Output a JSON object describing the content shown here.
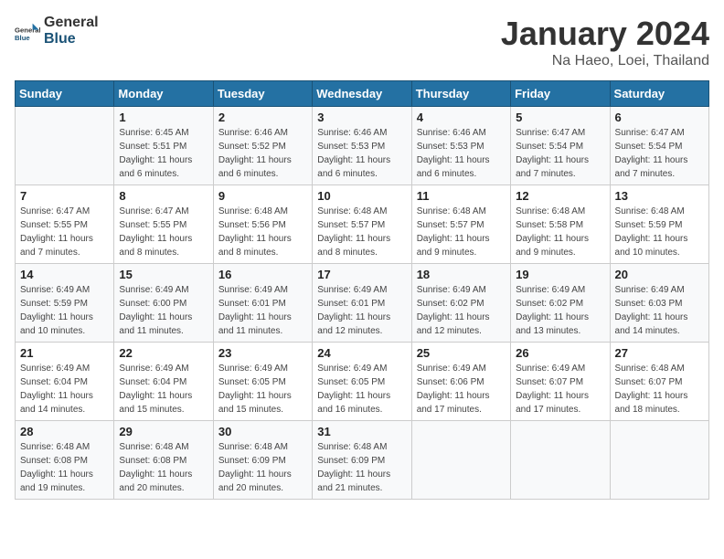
{
  "header": {
    "logo_general": "General",
    "logo_blue": "Blue",
    "month_title": "January 2024",
    "location": "Na Haeo, Loei, Thailand"
  },
  "calendar": {
    "weekdays": [
      "Sunday",
      "Monday",
      "Tuesday",
      "Wednesday",
      "Thursday",
      "Friday",
      "Saturday"
    ],
    "weeks": [
      [
        {
          "day": "",
          "info": ""
        },
        {
          "day": "1",
          "info": "Sunrise: 6:45 AM\nSunset: 5:51 PM\nDaylight: 11 hours\nand 6 minutes."
        },
        {
          "day": "2",
          "info": "Sunrise: 6:46 AM\nSunset: 5:52 PM\nDaylight: 11 hours\nand 6 minutes."
        },
        {
          "day": "3",
          "info": "Sunrise: 6:46 AM\nSunset: 5:53 PM\nDaylight: 11 hours\nand 6 minutes."
        },
        {
          "day": "4",
          "info": "Sunrise: 6:46 AM\nSunset: 5:53 PM\nDaylight: 11 hours\nand 6 minutes."
        },
        {
          "day": "5",
          "info": "Sunrise: 6:47 AM\nSunset: 5:54 PM\nDaylight: 11 hours\nand 7 minutes."
        },
        {
          "day": "6",
          "info": "Sunrise: 6:47 AM\nSunset: 5:54 PM\nDaylight: 11 hours\nand 7 minutes."
        }
      ],
      [
        {
          "day": "7",
          "info": "Sunrise: 6:47 AM\nSunset: 5:55 PM\nDaylight: 11 hours\nand 7 minutes."
        },
        {
          "day": "8",
          "info": "Sunrise: 6:47 AM\nSunset: 5:55 PM\nDaylight: 11 hours\nand 8 minutes."
        },
        {
          "day": "9",
          "info": "Sunrise: 6:48 AM\nSunset: 5:56 PM\nDaylight: 11 hours\nand 8 minutes."
        },
        {
          "day": "10",
          "info": "Sunrise: 6:48 AM\nSunset: 5:57 PM\nDaylight: 11 hours\nand 8 minutes."
        },
        {
          "day": "11",
          "info": "Sunrise: 6:48 AM\nSunset: 5:57 PM\nDaylight: 11 hours\nand 9 minutes."
        },
        {
          "day": "12",
          "info": "Sunrise: 6:48 AM\nSunset: 5:58 PM\nDaylight: 11 hours\nand 9 minutes."
        },
        {
          "day": "13",
          "info": "Sunrise: 6:48 AM\nSunset: 5:59 PM\nDaylight: 11 hours\nand 10 minutes."
        }
      ],
      [
        {
          "day": "14",
          "info": "Sunrise: 6:49 AM\nSunset: 5:59 PM\nDaylight: 11 hours\nand 10 minutes."
        },
        {
          "day": "15",
          "info": "Sunrise: 6:49 AM\nSunset: 6:00 PM\nDaylight: 11 hours\nand 11 minutes."
        },
        {
          "day": "16",
          "info": "Sunrise: 6:49 AM\nSunset: 6:01 PM\nDaylight: 11 hours\nand 11 minutes."
        },
        {
          "day": "17",
          "info": "Sunrise: 6:49 AM\nSunset: 6:01 PM\nDaylight: 11 hours\nand 12 minutes."
        },
        {
          "day": "18",
          "info": "Sunrise: 6:49 AM\nSunset: 6:02 PM\nDaylight: 11 hours\nand 12 minutes."
        },
        {
          "day": "19",
          "info": "Sunrise: 6:49 AM\nSunset: 6:02 PM\nDaylight: 11 hours\nand 13 minutes."
        },
        {
          "day": "20",
          "info": "Sunrise: 6:49 AM\nSunset: 6:03 PM\nDaylight: 11 hours\nand 14 minutes."
        }
      ],
      [
        {
          "day": "21",
          "info": "Sunrise: 6:49 AM\nSunset: 6:04 PM\nDaylight: 11 hours\nand 14 minutes."
        },
        {
          "day": "22",
          "info": "Sunrise: 6:49 AM\nSunset: 6:04 PM\nDaylight: 11 hours\nand 15 minutes."
        },
        {
          "day": "23",
          "info": "Sunrise: 6:49 AM\nSunset: 6:05 PM\nDaylight: 11 hours\nand 15 minutes."
        },
        {
          "day": "24",
          "info": "Sunrise: 6:49 AM\nSunset: 6:05 PM\nDaylight: 11 hours\nand 16 minutes."
        },
        {
          "day": "25",
          "info": "Sunrise: 6:49 AM\nSunset: 6:06 PM\nDaylight: 11 hours\nand 17 minutes."
        },
        {
          "day": "26",
          "info": "Sunrise: 6:49 AM\nSunset: 6:07 PM\nDaylight: 11 hours\nand 17 minutes."
        },
        {
          "day": "27",
          "info": "Sunrise: 6:48 AM\nSunset: 6:07 PM\nDaylight: 11 hours\nand 18 minutes."
        }
      ],
      [
        {
          "day": "28",
          "info": "Sunrise: 6:48 AM\nSunset: 6:08 PM\nDaylight: 11 hours\nand 19 minutes."
        },
        {
          "day": "29",
          "info": "Sunrise: 6:48 AM\nSunset: 6:08 PM\nDaylight: 11 hours\nand 20 minutes."
        },
        {
          "day": "30",
          "info": "Sunrise: 6:48 AM\nSunset: 6:09 PM\nDaylight: 11 hours\nand 20 minutes."
        },
        {
          "day": "31",
          "info": "Sunrise: 6:48 AM\nSunset: 6:09 PM\nDaylight: 11 hours\nand 21 minutes."
        },
        {
          "day": "",
          "info": ""
        },
        {
          "day": "",
          "info": ""
        },
        {
          "day": "",
          "info": ""
        }
      ]
    ]
  }
}
